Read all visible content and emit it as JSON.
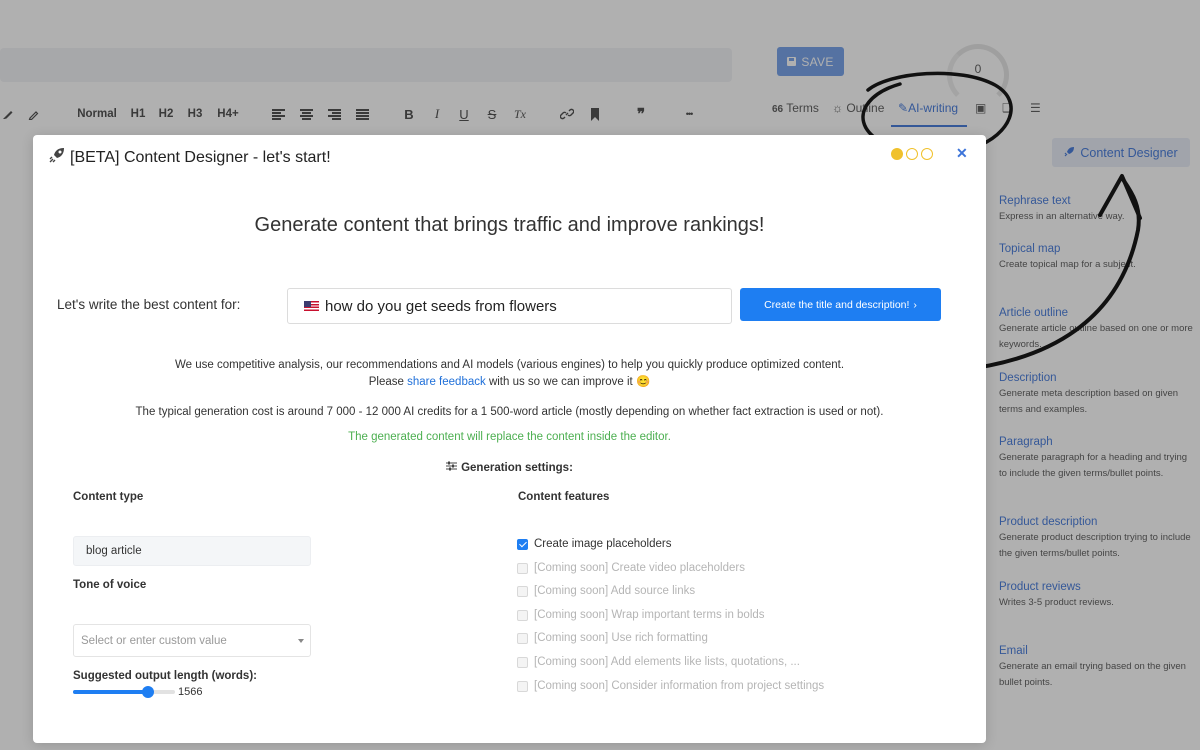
{
  "editor": {
    "save_label": "SAVE",
    "score": "0",
    "toolbar": {
      "normal": "Normal",
      "h1": "H1",
      "h2": "H2",
      "h3": "H3",
      "h4": "H4+",
      "bold": "B",
      "italic": "I",
      "underline": "U",
      "strike": "S",
      "clear": "Tx",
      "quote": "❞",
      "more": "•••"
    },
    "tabs": [
      {
        "label": "Terms",
        "icon": "terms-icon"
      },
      {
        "label": "Outline",
        "icon": "bulb-icon"
      },
      {
        "label": "AI-writing",
        "icon": "pen-icon",
        "active": true
      },
      {
        "label": "",
        "icon": "images-icon"
      },
      {
        "label": "",
        "icon": "chat-icon"
      },
      {
        "label": "",
        "icon": "list-icon"
      }
    ],
    "content_designer_button": "Content Designer",
    "sidebar": [
      {
        "title": "Rephrase text",
        "desc": "Express in an alternative way."
      },
      {
        "title": "Topical map",
        "desc": "Create topical map for a subject."
      },
      {
        "title": "Article outline",
        "desc": "Generate article outline based on one or more keywords."
      },
      {
        "title": "Description",
        "desc": "Generate meta description based on given terms and examples."
      },
      {
        "title": "Paragraph",
        "desc": "Generate paragraph for a heading and trying to include the given terms/bullet points."
      },
      {
        "title": "Product description",
        "desc": "Generate product description trying to include the given terms/bullet points."
      },
      {
        "title": "Product reviews",
        "desc": "Writes 3-5 product reviews."
      },
      {
        "title": "Email",
        "desc": "Generate an email trying based on the given bullet points."
      }
    ]
  },
  "modal": {
    "title": "[BETA] Content Designer - let's start!",
    "steps_total": 3,
    "step_current": 1,
    "headline": "Generate content that brings traffic and improve rankings!",
    "prompt_label": "Let's write the best content for:",
    "topic_value": "how do you get seeds from flowers",
    "create_button": "Create the title and description!",
    "info_text_1": "We use competitive analysis, our recommendations and AI models (various engines) to help you quickly produce optimized content.",
    "info_text_2_pre": "Please",
    "info_link": "share feedback",
    "info_text_2_post": "with us so we can improve it 😊",
    "cost_text": "The typical generation cost is around 7 000 - 12 000 AI credits for a 1 500-word article (mostly depending on whether fact extraction is used or not).",
    "replace_text": "The generated content will replace the content inside the editor.",
    "settings_title": "Generation settings:",
    "content_type_label": "Content type",
    "content_type_value": "blog article",
    "tone_label": "Tone of voice",
    "tone_placeholder": "Select or enter custom value",
    "length_label": "Suggested output length (words):",
    "length_value": "1566",
    "length_fraction": 0.74,
    "features_label": "Content features",
    "features": [
      {
        "label": "Create image placeholders",
        "checked": true,
        "enabled": true
      },
      {
        "label": "[Coming soon] Create video placeholders",
        "checked": false,
        "enabled": false
      },
      {
        "label": "[Coming soon] Add source links",
        "checked": false,
        "enabled": false
      },
      {
        "label": "[Coming soon] Wrap important terms in bolds",
        "checked": false,
        "enabled": false
      },
      {
        "label": "[Coming soon] Use rich formatting",
        "checked": false,
        "enabled": false
      },
      {
        "label": "[Coming soon] Add elements like lists, quotations, ...",
        "checked": false,
        "enabled": false
      },
      {
        "label": "[Coming soon] Consider information from project settings",
        "checked": false,
        "enabled": false
      }
    ]
  },
  "colors": {
    "accent": "#1e7ef2",
    "link": "#3d74d9",
    "success": "#4caf50",
    "step_dot": "#f0c12c"
  }
}
